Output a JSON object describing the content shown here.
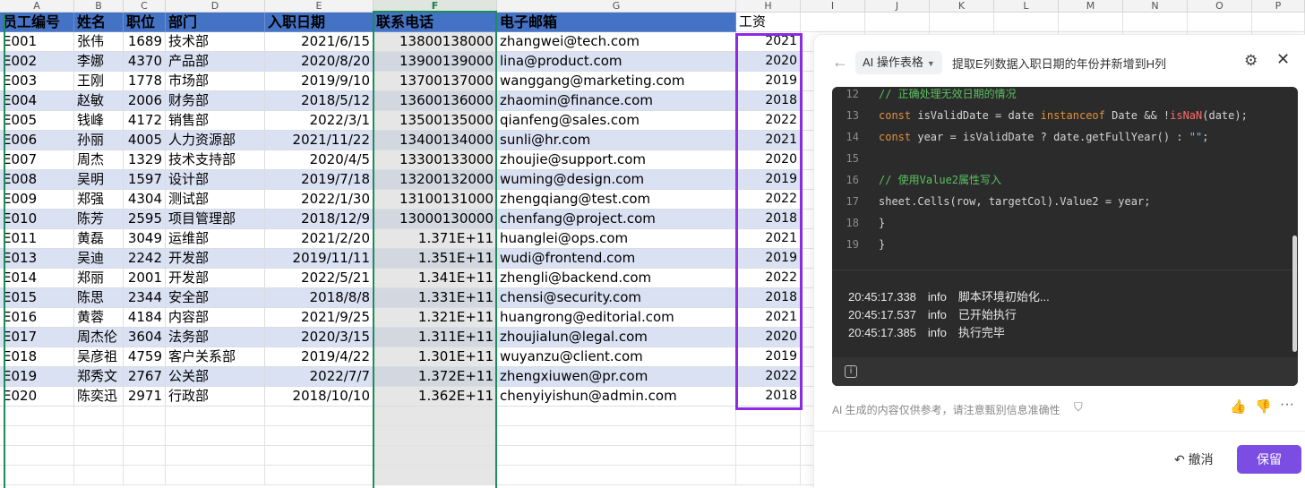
{
  "columns": [
    "A",
    "B",
    "C",
    "D",
    "E",
    "F",
    "G",
    "H",
    "I",
    "J",
    "K",
    "L",
    "M",
    "N",
    "O",
    "P"
  ],
  "headers": [
    "员工编号",
    "姓名",
    "职位",
    "部门",
    "入职日期",
    "联系电话",
    "电子邮箱",
    "工资"
  ],
  "rows": [
    [
      "E001",
      "张伟",
      "1689",
      "技术部",
      "2021/6/15",
      "13800138000",
      "zhangwei@tech.com",
      "2021"
    ],
    [
      "E002",
      "李娜",
      "4370",
      "产品部",
      "2020/8/20",
      "13900139000",
      "lina@product.com",
      "2020"
    ],
    [
      "E003",
      "王刚",
      "1778",
      "市场部",
      "2019/9/10",
      "13700137000",
      "wanggang@marketing.com",
      "2019"
    ],
    [
      "E004",
      "赵敏",
      "2006",
      "财务部",
      "2018/5/12",
      "13600136000",
      "zhaomin@finance.com",
      "2018"
    ],
    [
      "E005",
      "钱峰",
      "4172",
      "销售部",
      "2022/3/1",
      "13500135000",
      "qianfeng@sales.com",
      "2022"
    ],
    [
      "E006",
      "孙丽",
      "4005",
      "人力资源部",
      "2021/11/22",
      "13400134000",
      "sunli@hr.com",
      "2021"
    ],
    [
      "E007",
      "周杰",
      "1329",
      "技术支持部",
      "2020/4/5",
      "13300133000",
      "zhoujie@support.com",
      "2020"
    ],
    [
      "E008",
      "吴明",
      "1597",
      "设计部",
      "2019/7/18",
      "13200132000",
      "wuming@design.com",
      "2019"
    ],
    [
      "E009",
      "郑强",
      "4304",
      "测试部",
      "2022/1/30",
      "13100131000",
      "zhengqiang@test.com",
      "2022"
    ],
    [
      "E010",
      "陈芳",
      "2595",
      "项目管理部",
      "2018/12/9",
      "13000130000",
      "chenfang@project.com",
      "2018"
    ],
    [
      "E011",
      "黄磊",
      "3049",
      "运维部",
      "2021/2/20",
      "1.371E+11",
      "huanglei@ops.com",
      "2021"
    ],
    [
      "E013",
      "吴迪",
      "2242",
      "开发部",
      "2019/11/11",
      "1.351E+11",
      "wudi@frontend.com",
      "2019"
    ],
    [
      "E014",
      "郑丽",
      "2001",
      "开发部",
      "2022/5/21",
      "1.341E+11",
      "zhengli@backend.com",
      "2022"
    ],
    [
      "E015",
      "陈思",
      "2344",
      "安全部",
      "2018/8/8",
      "1.331E+11",
      "chensi@security.com",
      "2018"
    ],
    [
      "E016",
      "黄蓉",
      "4184",
      "内容部",
      "2021/9/25",
      "1.321E+11",
      "huangrong@editorial.com",
      "2021"
    ],
    [
      "E017",
      "周杰伦",
      "3604",
      "法务部",
      "2020/3/15",
      "1.311E+11",
      "zhoujialun@legal.com",
      "2020"
    ],
    [
      "E018",
      "吴彦祖",
      "4759",
      "客户关系部",
      "2019/4/22",
      "1.301E+11",
      "wuyanzu@client.com",
      "2019"
    ],
    [
      "E019",
      "郑秀文",
      "2767",
      "公关部",
      "2022/7/7",
      "1.372E+11",
      "zhengxiuwen@pr.com",
      "2022"
    ],
    [
      "E020",
      "陈奕迅",
      "2971",
      "行政部",
      "2018/10/10",
      "1.362E+11",
      "chenyiyishun@admin.com",
      "2018"
    ]
  ],
  "panel": {
    "mode_label": "AI 操作表格",
    "task": "提取E列数据入职日期的年份并新增到H列",
    "code_lines": [
      {
        "no": "12",
        "html": "<span class=\"cm\">// 正确处理无效日期的情况</span>"
      },
      {
        "no": "13",
        "html": "<span class=\"kw\">const</span> isValidDate = date <span class=\"kw\">instanceof</span> Date &amp;&amp; !<span class=\"fn\">isNaN</span>(date);"
      },
      {
        "no": "14",
        "html": "<span class=\"kw\">const</span> year = isValidDate ? date.getFullYear() : <span class=\"st\">\"\"</span>;"
      },
      {
        "no": "15",
        "html": ""
      },
      {
        "no": "16",
        "html": "<span class=\"cm\">// 使用Value2属性写入</span>"
      },
      {
        "no": "17",
        "html": "sheet.Cells(row, targetCol).Value2 = year;"
      },
      {
        "no": "18",
        "html": "}"
      },
      {
        "no": "19",
        "html": "}"
      }
    ],
    "logs": [
      {
        "time": "20:45:17.338",
        "level": "info",
        "msg": "脚本环境初始化..."
      },
      {
        "time": "20:45:17.537",
        "level": "info",
        "msg": "已开始执行"
      },
      {
        "time": "20:45:17.385",
        "level": "info",
        "msg": "执行完毕"
      }
    ],
    "disclaimer": "AI 生成的内容仅供参考，请注意甄别信息准确性",
    "undo_label": "撤消",
    "keep_label": "保留"
  }
}
